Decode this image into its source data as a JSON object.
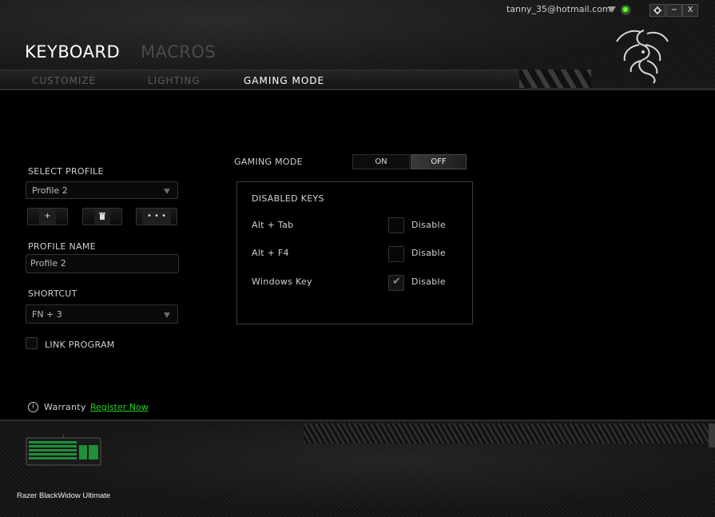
{
  "window": {
    "account_email": "tanny_35@hotmail.com",
    "settings_icon": "gear-icon",
    "minimize_label": "−",
    "close_label": "X"
  },
  "main_tabs": [
    {
      "label": "KEYBOARD",
      "active": true
    },
    {
      "label": "MACROS",
      "active": false
    }
  ],
  "sub_tabs": [
    {
      "label": "CUSTOMIZE",
      "active": false
    },
    {
      "label": "LIGHTING",
      "active": false
    },
    {
      "label": "GAMING MODE",
      "active": true
    }
  ],
  "profile": {
    "select_label": "SELECT PROFILE",
    "selected": "Profile 2",
    "add_label": "+",
    "delete_icon": "trash-icon",
    "more_label": "• • •",
    "name_label": "PROFILE NAME",
    "name_value": "Profile 2",
    "shortcut_label": "SHORTCUT",
    "shortcut_value": "FN + 3",
    "link_program_label": "LINK PROGRAM",
    "link_program_checked": false
  },
  "gaming_mode": {
    "label": "GAMING MODE",
    "on_label": "ON",
    "off_label": "OFF",
    "state": "OFF",
    "disabled_keys_title": "DISABLED KEYS",
    "keys": [
      {
        "name": "Alt + Tab",
        "disable_label": "Disable",
        "checked": false
      },
      {
        "name": "Alt + F4",
        "disable_label": "Disable",
        "checked": false
      },
      {
        "name": "Windows Key",
        "disable_label": "Disable",
        "checked": true
      }
    ]
  },
  "warranty": {
    "label": "Warranty",
    "link_label": "Register Now"
  },
  "device": {
    "name": "Razer BlackWidow Ultimate"
  },
  "colors": {
    "accent_green": "#1fd31f",
    "background": "#000000"
  }
}
